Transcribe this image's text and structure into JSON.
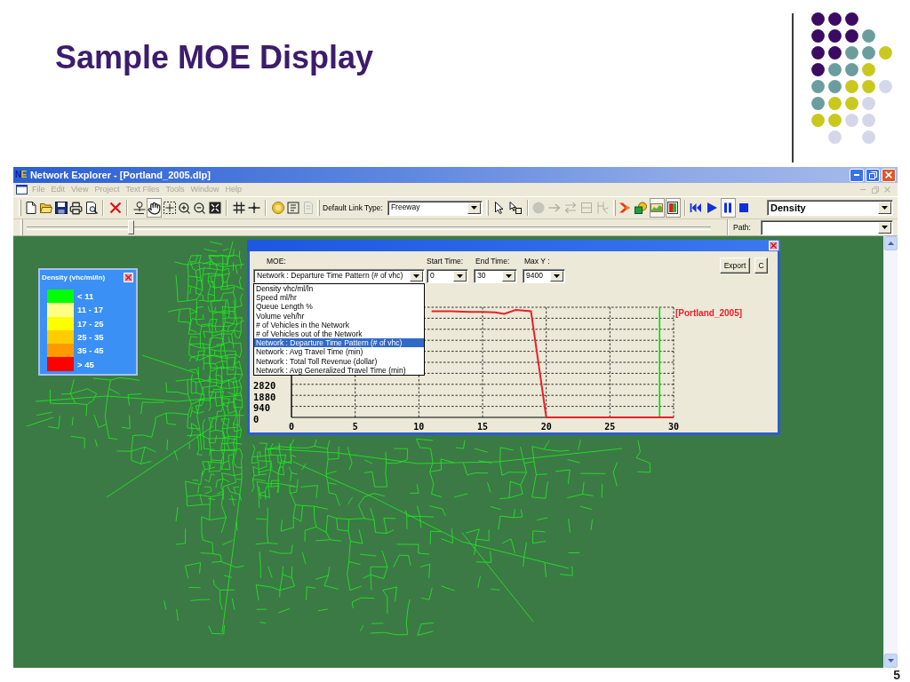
{
  "slide": {
    "title": "Sample MOE Display",
    "page_number": "5"
  },
  "window": {
    "logo": "NE",
    "title": "Network Explorer - [Portland_2005.dlp]"
  },
  "menu": [
    {
      "label": "File",
      "disabled": true
    },
    {
      "label": "Edit",
      "disabled": true
    },
    {
      "label": "View",
      "disabled": true
    },
    {
      "label": "Project",
      "disabled": true
    },
    {
      "label": "Text Files",
      "disabled": true
    },
    {
      "label": "Tools",
      "disabled": true
    },
    {
      "label": "Window",
      "disabled": true
    },
    {
      "label": "Help",
      "disabled": true
    }
  ],
  "toolbar": {
    "left_buttons": [
      {
        "pressed": false,
        "disabled": false
      },
      {
        "pressed": false,
        "disabled": false
      },
      {
        "pressed": false,
        "disabled": false
      },
      {
        "pressed": false,
        "disabled": false
      },
      {
        "pressed": false,
        "disabled": false
      },
      {
        "pressed": false,
        "disabled": false
      },
      {
        "pressed": false,
        "disabled": false
      },
      {
        "pressed": true,
        "disabled": false
      },
      {
        "pressed": false,
        "disabled": false
      },
      {
        "pressed": false,
        "disabled": false
      },
      {
        "pressed": false,
        "disabled": false
      },
      {
        "pressed": false,
        "disabled": false
      },
      {
        "pressed": false,
        "disabled": false
      },
      {
        "pressed": false,
        "disabled": false
      },
      {
        "pressed": false,
        "disabled": false
      },
      {
        "pressed": false,
        "disabled": false
      },
      {
        "pressed": false,
        "disabled": true
      }
    ],
    "link_type": {
      "label": "Default Link Type:",
      "value": "Freeway"
    },
    "right_buttons": [
      {
        "pressed": false,
        "disabled": false
      },
      {
        "pressed": false,
        "disabled": false
      },
      {
        "pressed": false,
        "disabled": true
      },
      {
        "pressed": false,
        "disabled": true
      },
      {
        "pressed": false,
        "disabled": true
      },
      {
        "pressed": false,
        "disabled": true
      },
      {
        "pressed": false,
        "disabled": true
      },
      {
        "pressed": false,
        "disabled": false
      },
      {
        "pressed": false,
        "disabled": false
      },
      {
        "pressed": true,
        "disabled": false
      },
      {
        "pressed": true,
        "disabled": false
      },
      {
        "pressed": false,
        "disabled": false
      },
      {
        "pressed": false,
        "disabled": false
      },
      {
        "pressed": true,
        "disabled": false
      },
      {
        "pressed": false,
        "disabled": false
      }
    ],
    "layer": {
      "value": "Density"
    }
  },
  "timebar": {
    "level": 0.15,
    "path": {
      "label": "Path:"
    }
  },
  "legend": {
    "title": "Density (vhc/ml/ln)",
    "items": [
      {
        "label": "< 11",
        "color": "#00ff00"
      },
      {
        "label": "11 - 17",
        "color": "#ffff88"
      },
      {
        "label": "17 - 25",
        "color": "#ffff00"
      },
      {
        "label": "25 - 35",
        "color": "#ffcc00"
      },
      {
        "label": "35 - 45",
        "color": "#ff9900"
      },
      {
        "label": "> 45",
        "color": "#ff0000"
      }
    ]
  },
  "moe_window": {
    "moe": {
      "label": "MOE:",
      "value": "Network : Departure Time Pattern (# of vhc)",
      "options": [
        {
          "label": "Density vhc/ml/ln",
          "selected": false
        },
        {
          "label": "Speed ml/hr",
          "selected": false
        },
        {
          "label": "Queue Length %",
          "selected": false
        },
        {
          "label": "Volume veh/hr",
          "selected": false
        },
        {
          "label": "# of Vehicles in the Network",
          "selected": false
        },
        {
          "label": "# of Vehicles out of the Network",
          "selected": false
        },
        {
          "label": "Network : Departure Time Pattern (# of vhc)",
          "selected": true
        },
        {
          "label": "Network : Avg Travel Time (min)",
          "selected": false
        },
        {
          "label": "Network : Total Toll Revenue (dollar)",
          "selected": false
        },
        {
          "label": "Network : Avg Generalized Travel Time (min)",
          "selected": false
        }
      ]
    },
    "start_time": {
      "label": "Start Time:",
      "value": "0"
    },
    "end_time": {
      "label": "End Time:",
      "value": "30"
    },
    "max_y": {
      "label": "Max Y :",
      "value": "9400"
    },
    "buttons": [
      "Export",
      "C"
    ],
    "chart_data": {
      "type": "line",
      "x": [
        11,
        12,
        13,
        14,
        15,
        16,
        16.7,
        17.6,
        18.8,
        20,
        25,
        30
      ],
      "series": [
        {
          "name": "[Portland_2005]",
          "color": "#e8202a",
          "values": [
            9060,
            9070,
            9040,
            9000,
            9000,
            8960,
            8840,
            9170,
            9070,
            0,
            0,
            0
          ]
        }
      ],
      "xlim": [
        0,
        30
      ],
      "ylim": [
        0,
        9400
      ],
      "xticks": [
        0,
        5,
        10,
        15,
        20,
        25,
        30
      ],
      "yticks": [
        0,
        940,
        1880,
        2820
      ],
      "grid": true,
      "ref_lines": [
        {
          "axis": "x",
          "value": 28.9,
          "color": "#00dd00"
        }
      ]
    }
  }
}
